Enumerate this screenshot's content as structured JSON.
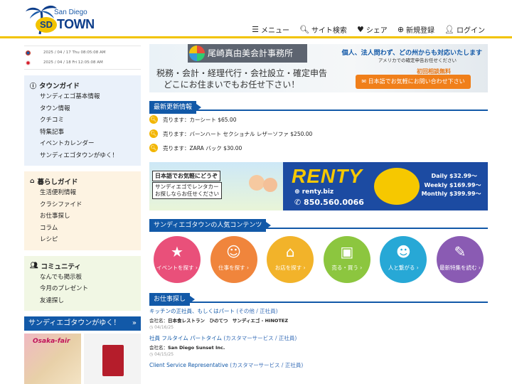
{
  "header": {
    "logo_city": "San Diego",
    "logo_sd": "SD",
    "logo_town": "TOWN",
    "nav": [
      {
        "icon": "menu-icon",
        "label": "メニュー"
      },
      {
        "icon": "search-icon",
        "label": "サイト検索"
      },
      {
        "icon": "heart-icon",
        "label": "シェア"
      },
      {
        "icon": "plus-circle-icon",
        "label": "新規登録"
      },
      {
        "icon": "user-icon",
        "label": "ログイン"
      }
    ]
  },
  "dates": [
    {
      "flag": "us-flag-icon",
      "text": "2025 / 04 / 17 Thu 08:05:08 AM"
    },
    {
      "flag": "jp-flag-icon",
      "text": "2025 / 04 / 18 Fri 12:05:08 AM"
    }
  ],
  "sidebar": {
    "town_guide": {
      "title": "タウンガイド",
      "items": [
        "サンディエゴ基本情報",
        "タウン情報",
        "クチコミ",
        "特集記事",
        "イベントカレンダー",
        "サンディエゴタウンがゆく！"
      ]
    },
    "life_guide": {
      "title": "暮らしガイド",
      "items": [
        "生活便利情報",
        "クラシファイド",
        "お仕事探し",
        "コラム",
        "レシピ"
      ]
    },
    "community": {
      "title": "コミュニティ",
      "items": [
        "なんでも掲示板",
        "今月のプレゼント",
        "友達探し"
      ]
    },
    "goes_title": "サンディエゴタウンがゆく！",
    "goes_arrow": "»",
    "thumb1_text": "Osaka-fair"
  },
  "ad1": {
    "firm": "尾崎真由美会計事務所",
    "line1": "税務・会計・経理代行・会社設立・確定申告",
    "line2": "どこにお住まいでもお任せ下さい！",
    "right1": "個人、法人問わず、どの州からも対応いたします",
    "right2": "アメリカでの確定申告お任せください",
    "right3": "初回相談無料",
    "cta": "日本語でお気軽にお問い合わせ下さい"
  },
  "news": {
    "title": "最新更新情報",
    "items": [
      "売ります：カーシート $65.00",
      "売ります：バーンハート セクショナル レザーソファ $250.00",
      "売ります：ZARA バック $30.00"
    ]
  },
  "ad2": {
    "box1": "日本語でお気軽にどうぞ",
    "box2_line1": "サンディエゴでレンタカー",
    "box2_line2": "お探しならお任せください",
    "brand": "RENTY",
    "site": "renty.biz",
    "phone": "850.560.0066",
    "rates": [
      {
        "label": "Daily",
        "value": "$32.99〜"
      },
      {
        "label": "Weekly",
        "value": "$169.99〜"
      },
      {
        "label": "Monthly",
        "value": "$399.99〜"
      }
    ]
  },
  "popular": {
    "title": "サンディエゴタウンの人気コンテンツ",
    "items": [
      {
        "icon": "calendar-star-icon",
        "label": "イベントを探す ›"
      },
      {
        "icon": "worker-icon",
        "label": "仕事を探す ›"
      },
      {
        "icon": "shop-icon",
        "label": "お店を探す ›"
      },
      {
        "icon": "shopping-bag-icon",
        "label": "売る・買う ›"
      },
      {
        "icon": "chat-people-icon",
        "label": "人と繋がる ›"
      },
      {
        "icon": "quill-icon",
        "label": "最新特集を読む ›"
      }
    ]
  },
  "jobs": {
    "title": "お仕事探し",
    "items": [
      {
        "title": "キッチンの正社員、もしくはパート",
        "category": "(その他 / 正社員)",
        "company_label": "会社名：",
        "company": "日本食レストラン　ひのてつ　サンディエゴ - HINOTEZ",
        "date": "04/16/25"
      },
      {
        "title": "社員 フルタイム パートタイム",
        "category": "(カスタマーサービス / 正社員)",
        "company_label": "会社名：",
        "company": "San Diego Sunset Inc.",
        "date": "04/15/25"
      },
      {
        "title": "Client Service Representative",
        "category": "(カスタマーサービス / 正社員)",
        "company_label": "",
        "company": "",
        "date": ""
      }
    ]
  },
  "colors": {
    "primary": "#1259a8",
    "accent": "#f2c300",
    "orange": "#f07f1a"
  }
}
